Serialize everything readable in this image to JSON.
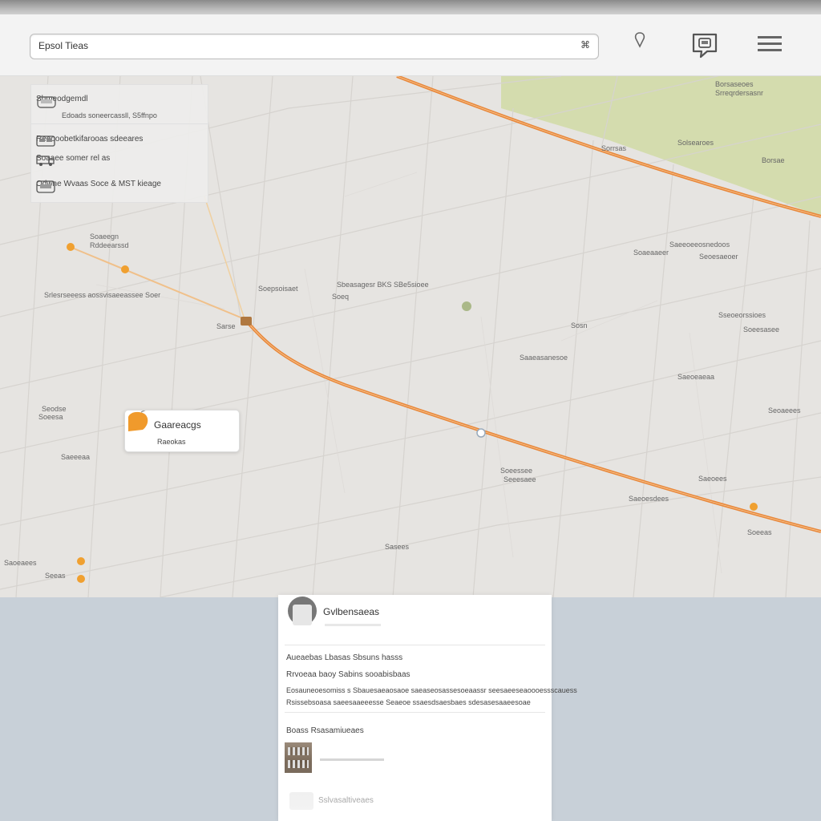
{
  "toolbar": {
    "search_value": "Epsol Tieas",
    "clear_glyph": "⌘",
    "icons": [
      "location-pin-icon",
      "map-sign-icon",
      "menu-icon"
    ]
  },
  "legend": {
    "top_title": "Sbmeodgemdl",
    "top_subtitle": "Edoads soneercassll, S5ffnpo",
    "rows": [
      {
        "icon": "bus-icon",
        "label": "Reeooobetkifarooas sdeeares"
      },
      {
        "icon": "truck-icon",
        "label": "Soaaee somer rel as"
      },
      {
        "icon": "car-icon",
        "label": "Odwne Wvaas  Soce & MST kieage"
      }
    ]
  },
  "map_labels": [
    {
      "text": "Soaeegn"
    },
    {
      "text": "Rddeearssd"
    },
    {
      "text": "Srlesrseeess aossvisaeeassee Soer"
    },
    {
      "text": "Sarse"
    },
    {
      "text": "Soepsoisaet"
    },
    {
      "text": "Sbeasagesr BKS SBe5sioee"
    },
    {
      "text": "Soeq"
    },
    {
      "text": "Borsaseoes"
    },
    {
      "text": "Srreqrdersasnr"
    },
    {
      "text": "Sorrsas"
    },
    {
      "text": "Solsearoes"
    },
    {
      "text": "Borsae"
    },
    {
      "text": "Saeeoeeosnedoos"
    },
    {
      "text": "Soaeaaeer"
    },
    {
      "text": "Seoesaeoer"
    },
    {
      "text": "Sseoeorssioes"
    },
    {
      "text": "Soeesasee"
    },
    {
      "text": "Sosn"
    },
    {
      "text": "Saaeasanesoe"
    },
    {
      "text": "Saeoeaeaa"
    },
    {
      "text": "Seoaeees"
    },
    {
      "text": "Seodse"
    },
    {
      "text": "Soeesa"
    },
    {
      "text": "Saeeeaa"
    },
    {
      "text": "Soeessee"
    },
    {
      "text": "Seeesaee"
    },
    {
      "text": "Saeoesdees"
    },
    {
      "text": "Saeoees"
    },
    {
      "text": "Soeeas"
    },
    {
      "text": "Sasees"
    },
    {
      "text": "Saoeaees"
    },
    {
      "text": "Seeas"
    }
  ],
  "popup": {
    "title": "Gaareacgs",
    "subtitle": "Raeokas"
  },
  "panel": {
    "title": "Gvlbensaeas",
    "line1": "Aueaebas  Lbasas Sbsuns hasss",
    "line2": "Rrvoeaa baoy Sabins sooabisbaas",
    "line3": "Eosauneoesomiss s Sbauesaeaosaoe saeaseosassesoeaassr seesaeeseaoooessscauess",
    "line4": "Rsissebsoasa saeesaaeeesse Seaeoe ssaesdsaesbaes sdesasesaaeesoae",
    "section": "Boass  Rsasamiueaes",
    "bottom_label": "Sslvasaltiveaes"
  },
  "colors": {
    "road": "#e8873a",
    "park": "#d4dcae",
    "map_bg": "#e6e4e1",
    "marker": "#f0a030"
  }
}
